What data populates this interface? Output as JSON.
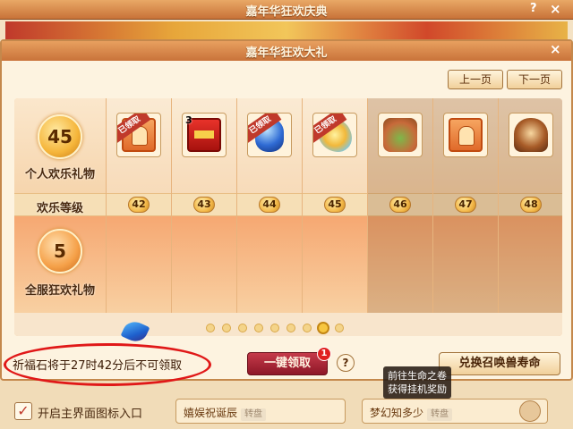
{
  "background_window": {
    "title": "嘉年华狂欢庆典",
    "help_label": "?",
    "close_label": "×",
    "show_icon_label": "开启主界面图标入口",
    "checkbox_mark": "✓",
    "field_left_label": "嬉娱祝诞辰",
    "field_left_hint": "转盘",
    "field_right_label": "梦幻知多少",
    "field_right_hint": "转盘"
  },
  "dialog": {
    "title": "嘉年华狂欢大礼",
    "close_label": "×",
    "prev_page": "上一页",
    "next_page": "下一页"
  },
  "panel": {
    "personal": {
      "level": "45",
      "label": "个人欢乐礼物"
    },
    "level_row_label": "欢乐等级",
    "global": {
      "level": "5",
      "label": "全服狂欢礼物"
    },
    "claimed_label": "已领取",
    "columns": [
      {
        "level": "42",
        "icon": "card-icon",
        "claimed": true,
        "count": "",
        "locked": false
      },
      {
        "level": "43",
        "icon": "red-envelope-icon",
        "claimed": false,
        "count": "3",
        "locked": false
      },
      {
        "level": "44",
        "icon": "blue-egg-icon",
        "claimed": true,
        "count": "",
        "locked": false
      },
      {
        "level": "45",
        "icon": "butterfly-icon",
        "claimed": true,
        "count": "",
        "locked": false
      },
      {
        "level": "46",
        "icon": "food-icon",
        "claimed": false,
        "count": "",
        "locked": true
      },
      {
        "level": "47",
        "icon": "card-icon",
        "claimed": false,
        "count": "",
        "locked": true
      },
      {
        "level": "48",
        "icon": "pot-icon",
        "claimed": false,
        "count": "",
        "locked": true
      }
    ],
    "page_dots": 9,
    "active_page": 8
  },
  "footer": {
    "notice": "祈福石将于27时42分后不可领取",
    "claim_all": "一键领取",
    "claim_badge": "1",
    "help_label": "?",
    "exchange": "兑换召唤兽寿命",
    "tooltip_line1": "前往生命之卷",
    "tooltip_line2": "获得挂机奖励"
  }
}
